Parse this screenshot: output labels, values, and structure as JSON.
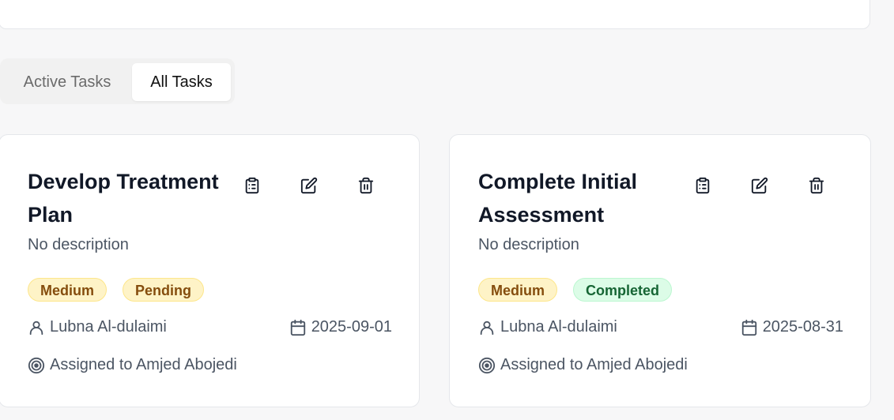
{
  "tabs": [
    {
      "label": "Active Tasks",
      "active": false
    },
    {
      "label": "All Tasks",
      "active": true
    }
  ],
  "tasks": [
    {
      "title": "Develop Treatment Plan",
      "description": "No description",
      "priority": "Medium",
      "status": "Pending",
      "owner": "Lubna Al-dulaimi",
      "date": "2025-09-01",
      "assigned": "Assigned to Amjed Abojedi"
    },
    {
      "title": "Complete Initial Assessment",
      "description": "No description",
      "priority": "Medium",
      "status": "Completed",
      "owner": "Lubna Al-dulaimi",
      "date": "2025-08-31",
      "assigned": "Assigned to Amjed Abojedi"
    }
  ],
  "icons": {
    "view": "clipboard-list-icon",
    "edit": "edit-icon",
    "delete": "trash-icon",
    "owner": "user-icon",
    "date": "calendar-icon",
    "assigned": "target-icon"
  },
  "colors": {
    "pending_bg": "#fef3c7",
    "completed_bg": "#dcfce7"
  }
}
